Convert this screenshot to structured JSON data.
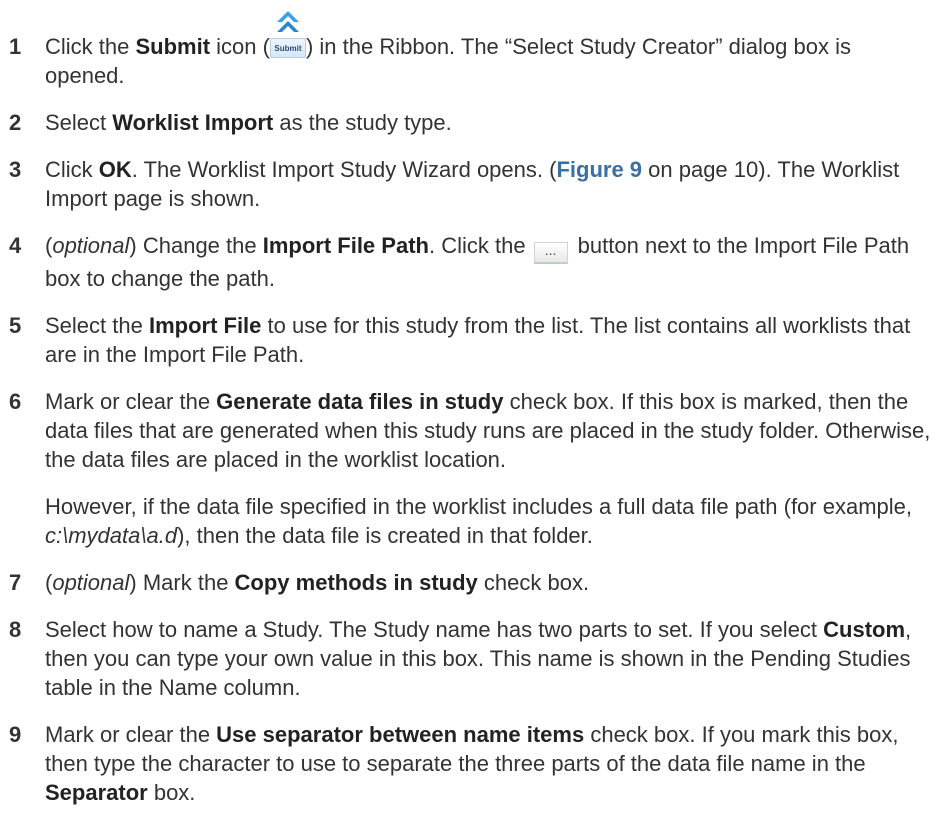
{
  "steps": [
    {
      "num": "1",
      "a": "Click the ",
      "b": "Submit",
      "c": " icon (",
      "icon_label": "Submit",
      "d": ") in the Ribbon. The “Select Study Creator” dialog box is opened."
    },
    {
      "num": "2",
      "a": "Select ",
      "b": "Worklist Import",
      "c": " as the study type."
    },
    {
      "num": "3",
      "a": "Click ",
      "b": "OK",
      "c": ". The Worklist Import Study Wizard opens. (",
      "link": "Figure 9",
      "d": " on page 10). The Worklist Import page is shown."
    },
    {
      "num": "4",
      "a": "(",
      "i": "optional",
      "c": ") Change the ",
      "b": "Import File Path",
      "d": ". Click the",
      "btn": "...",
      "e": " button next to the Import File Path box to change the path."
    },
    {
      "num": "5",
      "a": "Select the ",
      "b": "Import File",
      "c": " to use for this study from the list. The list contains all worklists that are in the Import File Path."
    },
    {
      "num": "6",
      "a": "Mark or clear the ",
      "b": "Generate data files in study",
      "c": " check box. If this box is marked, then the data files that are generated when this study runs are placed in the study folder. Otherwise, the data files are placed in the worklist location.",
      "p2a": "However, if the data file specified in the worklist includes a full data file path (for example, ",
      "p2i": "c:\\mydata\\a.d",
      "p2b": "), then the data file is created in that folder."
    },
    {
      "num": "7",
      "a": "(",
      "i": "optional",
      "c": ") Mark the ",
      "b": "Copy methods in study",
      "d": " check box."
    },
    {
      "num": "8",
      "a": "Select how to name a Study. The Study name has two parts to set. If you select ",
      "b": "Custom",
      "c": ", then you can type your own value in this box. This name is shown in the Pending Studies table in the Name column."
    },
    {
      "num": "9",
      "a": "Mark or clear the ",
      "b": "Use separator between name items",
      "c": " check box. If you mark this box, then type the character to use to separate the three parts of the data file name in the ",
      "b2": "Separator",
      "d": " box."
    }
  ],
  "icons": {
    "submit": "submit-icon",
    "browse": "browse-button"
  }
}
